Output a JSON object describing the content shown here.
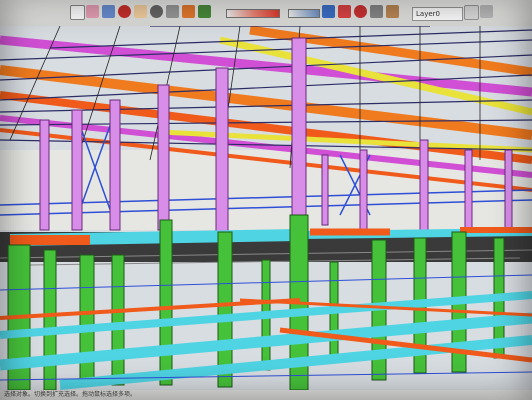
{
  "toolbar": {
    "layer_label": "Layer0",
    "buttons": [
      "select-tool",
      "eraser-tool",
      "paint-tool",
      "orbit-tool",
      "pan-tool",
      "zoom-tool",
      "zoom-extents-tool",
      "section-tool",
      "dimension-tool",
      "text-tool",
      "axes-tool",
      "tape-tool",
      "move-tool",
      "rotate-tool",
      "scale-tool",
      "offset-tool",
      "follow-me-tool",
      "push-pull-tool"
    ]
  },
  "status": {
    "text": "选择对象。切换到扩充选择。拖动鼠标选择多项。"
  },
  "colors": {
    "sky": "#d8dde2",
    "rafter_orange": "#f07a1e",
    "rafter_magenta": "#d14fd4",
    "purlin_yellow": "#e8e23a",
    "column_purple": "#d88ee8",
    "brace_blue": "#2f4fd6",
    "column_green": "#46c23a",
    "beam_cyan": "#4fd4e4",
    "beam_orange": "#f05a1a",
    "deck_grey": "#3a3a3a"
  },
  "icons": [
    "structure-model-icon"
  ]
}
